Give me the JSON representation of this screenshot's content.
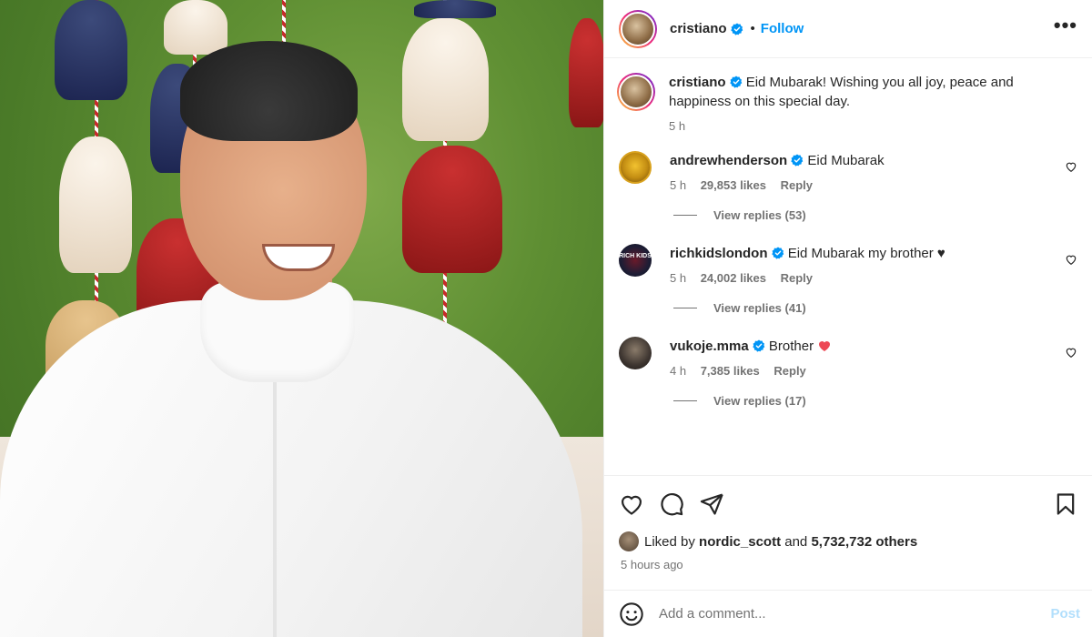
{
  "post": {
    "author": "cristiano",
    "follow_label": "Follow",
    "separator": "•",
    "more_label": "•••"
  },
  "caption": {
    "username": "cristiano",
    "text": "Eid Mubarak! Wishing you all joy, peace and happiness on this special day.",
    "time": "5 h"
  },
  "comments": [
    {
      "username": "andrewhenderson",
      "text": "Eid Mubarak",
      "time": "5 h",
      "likes": "29,853 likes",
      "reply": "Reply",
      "view_replies": "View replies (53)"
    },
    {
      "username": "richkidslondon",
      "text": "Eid Mubarak my brother ♥",
      "time": "5 h",
      "likes": "24,002 likes",
      "reply": "Reply",
      "view_replies": "View replies (41)"
    },
    {
      "username": "vukoje.mma",
      "text": "Brother",
      "time": "4 h",
      "likes": "7,385 likes",
      "reply": "Reply",
      "view_replies": "View replies (17)"
    }
  ],
  "rich_avatar_text": "RICH KIDS",
  "likes": {
    "prefix": "Liked by",
    "user": "nordic_scott",
    "middle": "and",
    "others": "5,732,732 others"
  },
  "posted_ago": "5 hours ago",
  "comment_box": {
    "placeholder": "Add a comment...",
    "post_label": "Post"
  },
  "icons": {
    "like": "heart-icon",
    "comment": "comment-icon",
    "share": "share-icon",
    "save": "bookmark-icon",
    "emoji": "emoji-icon",
    "verified": "verified-badge-icon"
  },
  "colors": {
    "accent": "#0095f6",
    "verified": "#0095f6",
    "heart_red": "#ed4956",
    "post_disabled": "#b2dffc"
  }
}
